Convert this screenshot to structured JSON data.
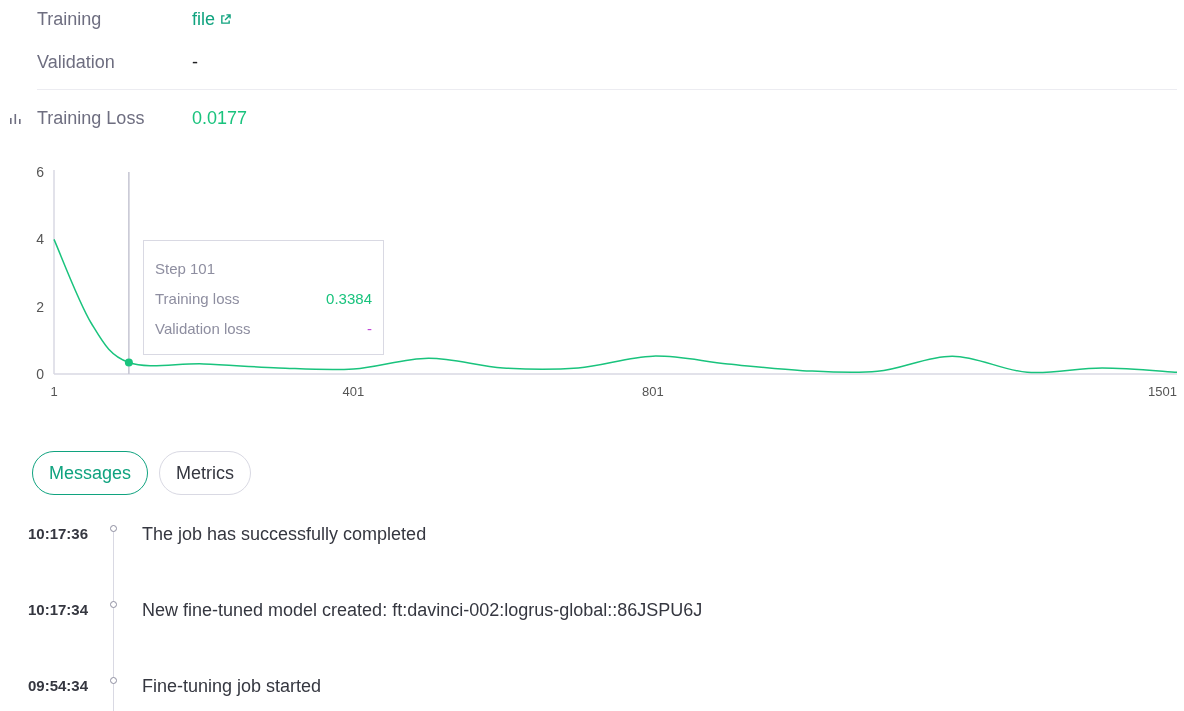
{
  "details": [
    {
      "label": "Training",
      "value": "file",
      "kind": "link"
    },
    {
      "label": "Validation",
      "value": "-",
      "kind": "text"
    }
  ],
  "metric": {
    "label": "Training Loss",
    "value": "0.0177"
  },
  "chart": {
    "chart_data": {
      "type": "line",
      "x": [
        1,
        51,
        101,
        201,
        301,
        401,
        501,
        601,
        701,
        801,
        901,
        1001,
        1101,
        1201,
        1301,
        1401,
        1501
      ],
      "xlim": [
        1,
        1501
      ],
      "ylim": [
        0,
        6
      ],
      "xticks": [
        1,
        401,
        801,
        1501
      ],
      "yticks": [
        0,
        2,
        4,
        6
      ],
      "ref_lines": [
        {
          "axis": "x",
          "value": 101,
          "label": "Step 101"
        }
      ],
      "series": [
        {
          "color": "#19c37d",
          "values": [
            4.0,
            1.5,
            0.34,
            0.3,
            0.18,
            0.15,
            0.47,
            0.18,
            0.18,
            0.53,
            0.3,
            0.1,
            0.08,
            0.53,
            0.05,
            0.18,
            0.05
          ]
        }
      ]
    },
    "tooltip": {
      "rows": [
        {
          "label": "Training loss",
          "value": "0.3384",
          "color": "#19c37d"
        },
        {
          "label": "Validation loss",
          "value": "-",
          "color": "#c046d6"
        }
      ]
    }
  },
  "tabs": [
    {
      "label": "Messages",
      "selected": true
    },
    {
      "label": "Metrics",
      "selected": false
    }
  ],
  "messages": [
    {
      "time": "10:17:36",
      "text": "The job has successfully completed"
    },
    {
      "time": "10:17:34",
      "text": "New fine-tuned model created: ft:davinci-002:logrus-global::86JSPU6J"
    },
    {
      "time": "09:54:34",
      "text": "Fine-tuning job started"
    }
  ]
}
